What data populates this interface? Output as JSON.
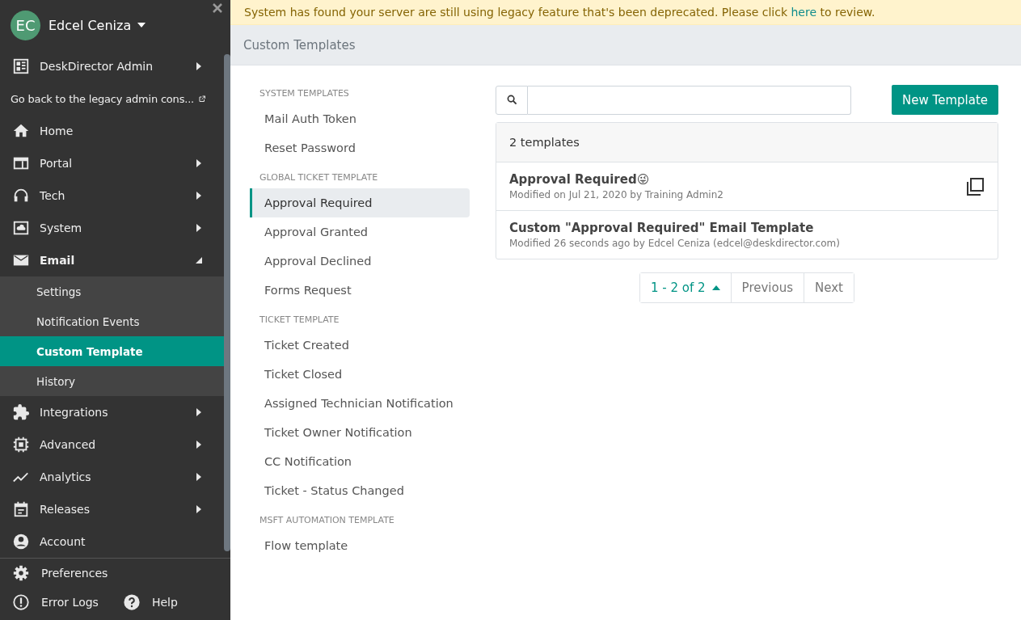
{
  "user": {
    "initials": "EC",
    "name": "Edcel Ceniza"
  },
  "nav": [
    {
      "label": "DeskDirector Admin",
      "kind": "menu",
      "expanded": false
    },
    {
      "label": "Go back to the legacy admin cons...",
      "kind": "external"
    },
    {
      "label": "Home",
      "kind": "menu"
    },
    {
      "label": "Portal",
      "kind": "menu",
      "expanded": false
    },
    {
      "label": "Tech",
      "kind": "menu",
      "expanded": false
    },
    {
      "label": "System",
      "kind": "menu",
      "expanded": false
    },
    {
      "label": "Email",
      "kind": "menu",
      "expanded": true,
      "children": [
        {
          "label": "Settings",
          "selected": false
        },
        {
          "label": "Notification Events",
          "selected": false
        },
        {
          "label": "Custom Template",
          "selected": true
        },
        {
          "label": "History",
          "selected": false
        }
      ]
    },
    {
      "label": "Integrations",
      "kind": "menu",
      "expanded": false
    },
    {
      "label": "Advanced",
      "kind": "menu",
      "expanded": false
    },
    {
      "label": "Analytics",
      "kind": "menu",
      "expanded": false
    },
    {
      "label": "Releases",
      "kind": "menu",
      "expanded": false
    },
    {
      "label": "Account",
      "kind": "menu"
    }
  ],
  "footer": {
    "preferences": "Preferences",
    "error_logs": "Error Logs",
    "help": "Help"
  },
  "banner": {
    "before": "System has found your server are still using legacy feature that's been deprecated. Please click ",
    "link": "here",
    "after": " to review."
  },
  "page_title": "Custom Templates",
  "template_groups": [
    {
      "title": "SYSTEM TEMPLATES",
      "items": [
        {
          "label": "Mail Auth Token",
          "selected": false
        },
        {
          "label": "Reset Password",
          "selected": false
        }
      ]
    },
    {
      "title": "GLOBAL TICKET TEMPLATE",
      "items": [
        {
          "label": "Approval Required",
          "selected": true
        },
        {
          "label": "Approval Granted",
          "selected": false
        },
        {
          "label": "Approval Declined",
          "selected": false
        },
        {
          "label": "Forms Request",
          "selected": false
        }
      ]
    },
    {
      "title": "TICKET TEMPLATE",
      "items": [
        {
          "label": "Ticket Created",
          "selected": false
        },
        {
          "label": "Ticket Closed",
          "selected": false
        },
        {
          "label": "Assigned Technician Notification",
          "selected": false
        },
        {
          "label": "Ticket Owner Notification",
          "selected": false
        },
        {
          "label": "CC Notification",
          "selected": false
        },
        {
          "label": "Ticket - Status Changed",
          "selected": false
        }
      ]
    },
    {
      "title": "MSFT AUTOMATION TEMPLATE",
      "items": [
        {
          "label": "Flow template",
          "selected": false
        }
      ]
    }
  ],
  "new_button": "New Template",
  "list_count": "2 templates",
  "templates": [
    {
      "title": "Approval Required😜",
      "meta": "Modified on Jul 21, 2020 by Training Admin2",
      "copyable": true
    },
    {
      "title": "Custom \"Approval Required\" Email Template",
      "meta": "Modified 26 seconds ago by Edcel Ceniza (edcel@deskdirector.com)",
      "copyable": false
    }
  ],
  "pagination": {
    "range": "1 - 2 of 2",
    "previous": "Previous",
    "next": "Next"
  }
}
